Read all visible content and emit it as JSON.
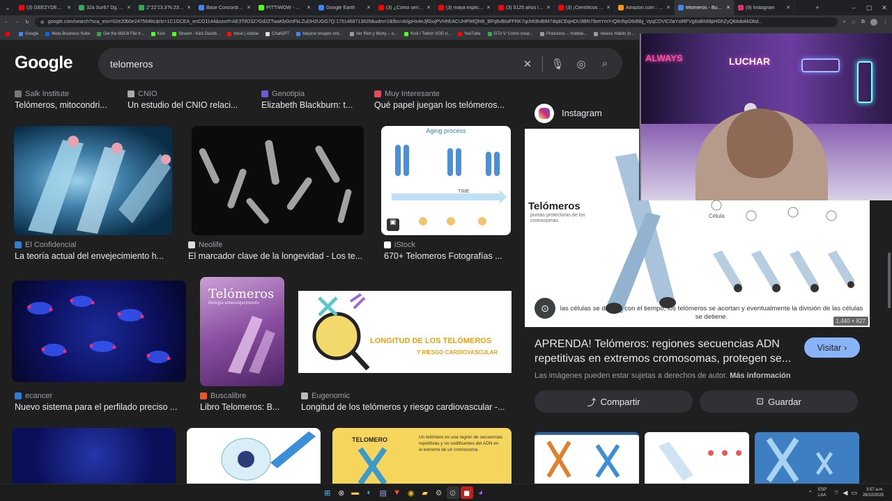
{
  "browser": {
    "tabs": [
      {
        "title": "(3) GEEZYDEE ❌ H",
        "color": "#ff0000",
        "active": false
      },
      {
        "title": "32a Sur67 Dg. 32 -",
        "color": "#34a853",
        "active": false
      },
      {
        "title": "2°22'13.3\"N 23°19'",
        "color": "#34a853",
        "active": false
      },
      {
        "title": "Base Concordia - G",
        "color": "#4285f4",
        "active": false
      },
      {
        "title": "PITTIWOW - Watch",
        "color": "#53fc18",
        "active": false
      },
      {
        "title": "Google Earth",
        "color": "#4285f4",
        "active": false
      },
      {
        "title": "(3) ¿Cómo sería un",
        "color": "#ff0000",
        "active": false
      },
      {
        "title": "(3) maya explica los",
        "color": "#ff0000",
        "active": false
      },
      {
        "title": "(3) 5125 años los m",
        "color": "#ff0000",
        "active": false
      },
      {
        "title": "(3) ¡Científicos dev",
        "color": "#ff0000",
        "active": false
      },
      {
        "title": "Amazon.com : bino",
        "color": "#ff9900",
        "active": false
      },
      {
        "title": "telomeros - Buscar",
        "color": "#4285f4",
        "active": true
      },
      {
        "title": "(9) Instagram",
        "color": "#e1306c",
        "active": false
      }
    ],
    "url": "google.com/search?sca_esv=02e20b0e2475648c&rlz=1C1GCEA_enCO1144&sxsrf=AE3TifO327Gd2ZTwaKbGmFkLZuDH2UGG7Q:1761468713629&udm=2&fbs=AIIjpHx4nJjfGojPVHhEACUHPiMQht6_BFq6vBIoFFRK7qchKBvBIM7dq8CEqHDU3BN7IbmYmYrQ6rIhpD6d6bj_VyqCDVIC0aYsIRFVg6sBIId9pHGhZyQ6AdokkDbd..."
  },
  "bookmarks": [
    {
      "label": "",
      "color": "#ff0000"
    },
    {
      "label": "Google",
      "color": "#4285f4"
    },
    {
      "label": "Meta Business Suite",
      "color": "#0866ff"
    },
    {
      "label": "Get the M3U8 File fr...",
      "color": "#34a853"
    },
    {
      "label": "Kick",
      "color": "#53fc18"
    },
    {
      "label": "Stream - Kick Dashb...",
      "color": "#53fc18"
    },
    {
      "label": "Inicio | Adobe",
      "color": "#fa0f00"
    },
    {
      "label": "ChatGPT",
      "color": "#dddddd"
    },
    {
      "label": "Mejorar imagen onli...",
      "color": "#4285f4"
    },
    {
      "label": "Ver Rick y Morty -- o...",
      "color": "#999999"
    },
    {
      "label": "Kick / Twitch VOD d...",
      "color": "#53fc18"
    },
    {
      "label": "YouTube",
      "color": "#ff0000"
    },
    {
      "label": "GTA V: Cómo crear...",
      "color": "#34a853"
    },
    {
      "label": "Productos -- Hobbie...",
      "color": "#999999"
    },
    {
      "label": "Atoesc Habits (h...",
      "color": "#999999"
    }
  ],
  "search": {
    "query": "telomeros"
  },
  "row0": [
    {
      "source": "Salk Institute",
      "title": "Telómeros, mitocondri..."
    },
    {
      "source": "CNIO",
      "title": "Un estudio del CNIO relaci..."
    },
    {
      "source": "Genotipia",
      "title": "Elizabeth Blackburn: t..."
    },
    {
      "source": "Muy Interesante",
      "title": "Qué papel juegan los telómeros..."
    }
  ],
  "row1": [
    {
      "source": "El Confidencial",
      "title": "La teoría actual del envejecimiento h..."
    },
    {
      "source": "Neolife",
      "title": "El marcador clave de la longevidad - Los te..."
    },
    {
      "source": "iStock",
      "title": "670+ Telomeros Fotografías ..."
    }
  ],
  "row2": [
    {
      "source": "ecancer",
      "title": "Nuevo sistema para el perfilado preciso ..."
    },
    {
      "source": "Buscalibre",
      "title": "Libro Telomeros: B..."
    },
    {
      "source": "Eugenomic",
      "title": "Longitud de los telómeros y riesgo cardiovascular -..."
    }
  ],
  "thumbs": {
    "istock_heading": "Aging process",
    "istock_time": "TIME",
    "book_title": "Telómeros",
    "book_sub": "Biología antienvejecimiento",
    "eugenomic_text1": "LONGITUD DE LOS TELÓMEROS",
    "eugenomic_text2": "Y RIESGO CARDIOVASCULAR",
    "bottom_label": "TELOMERO",
    "bottom_text": "Un telómero es una región de secuencias repetitivas y no codificantes del ADN en el extremo de un cromosoma."
  },
  "preview": {
    "site": "Instagram",
    "img_title": "Telómeros",
    "img_sub": "puntas protectoras de los cromosomas",
    "img_caption": "las células se dividen con el tiempo, los telómeros se acortan y eventualmente la división de las células se detiene.",
    "img_label": "Célula",
    "dims": "1,440 × 827",
    "title": "APRENDA! Telómeros: regiones secuencias ADN repetitivas en extremos cromosomas, protegen se...",
    "visit": "Visitar",
    "rights": "Las imágenes pueden estar sujetas a derechos de autor.",
    "more": "Más información",
    "share": "Compartir",
    "save": "Guardar"
  },
  "webcam": {
    "sign1": "ALWAYS",
    "sign2": "LUCHAR"
  },
  "tray": {
    "lang1": "ESP",
    "lang2": "LAA",
    "time": "3:57 a.m.",
    "date": "26/10/2025"
  }
}
